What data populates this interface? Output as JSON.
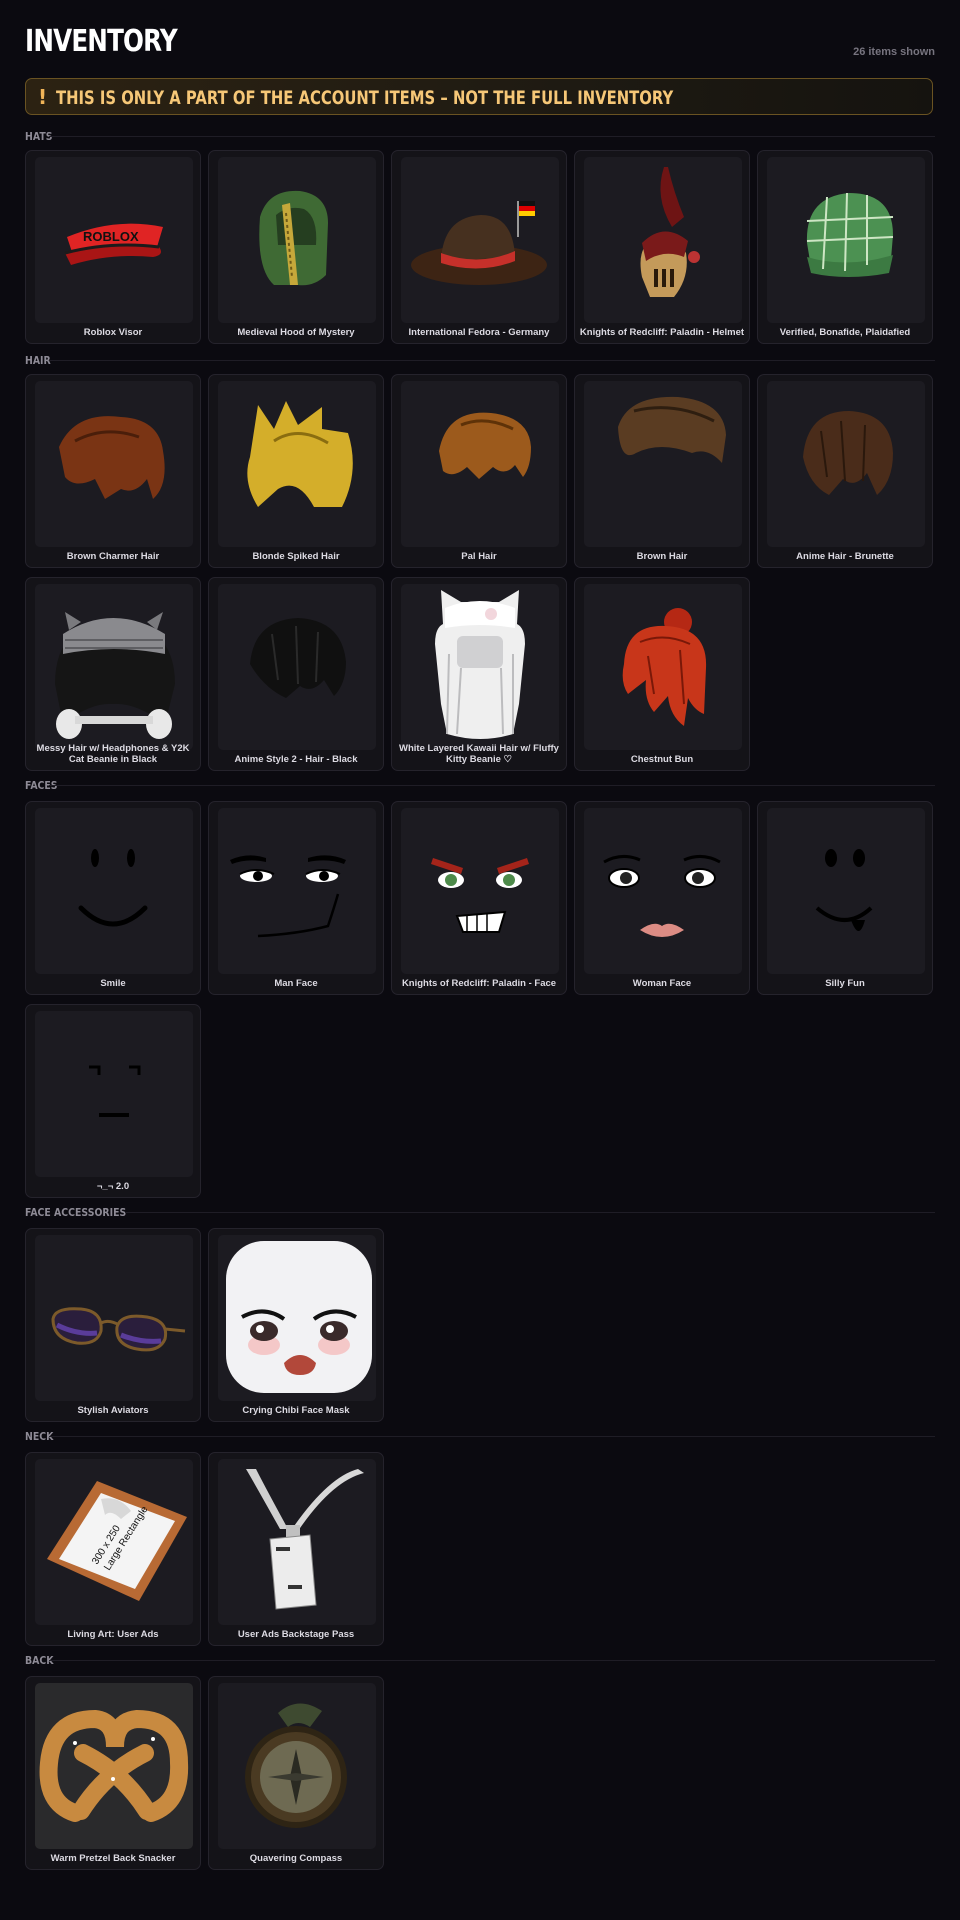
{
  "header": {
    "title": "INVENTORY",
    "count": "26 items shown"
  },
  "banner": {
    "icon": "!",
    "text": "THIS IS ONLY A PART OF THE ACCOUNT ITEMS – NOT THE FULL INVENTORY"
  },
  "sections": {
    "hats": {
      "label": "HATS",
      "items": [
        {
          "name": "Roblox Visor",
          "icon": "red-visor-icon"
        },
        {
          "name": "Medieval Hood of Mystery",
          "icon": "green-hood-icon"
        },
        {
          "name": "International Fedora - Germany",
          "icon": "fedora-icon"
        },
        {
          "name": "Knights of Redcliff: Paladin - Helmet",
          "icon": "knight-helmet-icon"
        },
        {
          "name": "Verified, Bonafide, Plaidafied",
          "icon": "plaid-cap-icon"
        }
      ]
    },
    "hair": {
      "label": "HAIR",
      "items": [
        {
          "name": "Brown Charmer Hair",
          "icon": "brown-hair-icon"
        },
        {
          "name": "Blonde Spiked Hair",
          "icon": "blonde-hair-icon"
        },
        {
          "name": "Pal Hair",
          "icon": "pal-hair-icon"
        },
        {
          "name": "Brown Hair",
          "icon": "brown-hair-icon"
        },
        {
          "name": "Anime Hair - Brunette",
          "icon": "brunette-hair-icon"
        },
        {
          "name": "Messy Hair w/ Headphones & Y2K Cat Beanie in Black",
          "icon": "beanie-headphones-icon"
        },
        {
          "name": "Anime Style 2 - Hair - Black",
          "icon": "black-hair-icon"
        },
        {
          "name": "White Layered Kawaii Hair w/ Fluffy Kitty Beanie ♡",
          "icon": "white-hair-icon"
        },
        {
          "name": "Chestnut Bun",
          "icon": "chestnut-bun-icon"
        }
      ]
    },
    "faces": {
      "label": "FACES",
      "items": [
        {
          "name": "Smile",
          "icon": "smile-face-icon"
        },
        {
          "name": "Man Face",
          "icon": "man-face-icon"
        },
        {
          "name": "Knights of Redcliff: Paladin - Face",
          "icon": "paladin-face-icon"
        },
        {
          "name": "Woman Face",
          "icon": "woman-face-icon"
        },
        {
          "name": "Silly Fun",
          "icon": "silly-face-icon"
        },
        {
          "name": "¬_¬ 2.0",
          "icon": "side-eye-face-icon"
        }
      ]
    },
    "face_accessories": {
      "label": "FACE ACCESSORIES",
      "items": [
        {
          "name": "Stylish Aviators",
          "icon": "aviators-icon"
        },
        {
          "name": "Crying Chibi Face Mask",
          "icon": "chibi-mask-icon"
        }
      ]
    },
    "neck": {
      "label": "NECK",
      "items": [
        {
          "name": "Living Art: User Ads",
          "icon": "framed-sign-icon",
          "art_text": [
            "300 x 250",
            "Large Rectangle"
          ]
        },
        {
          "name": "User Ads Backstage Pass",
          "icon": "lanyard-pass-icon"
        }
      ]
    },
    "back": {
      "label": "BACK",
      "items": [
        {
          "name": "Warm Pretzel Back Snacker",
          "icon": "pretzel-icon"
        },
        {
          "name": "Quavering Compass",
          "icon": "compass-icon"
        }
      ]
    }
  },
  "colors": {
    "background": "#0b0a10",
    "card": "#141318",
    "banner_text": "#f6c777",
    "banner_border": "#6a5322"
  }
}
